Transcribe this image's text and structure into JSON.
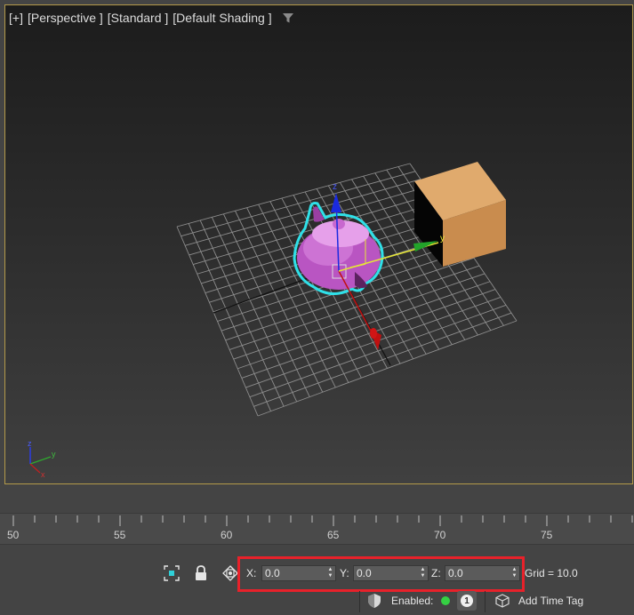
{
  "viewport": {
    "labels": [
      "[+]",
      "[Perspective ]",
      "[Standard ]",
      "[Default Shading ]"
    ],
    "axes": {
      "gizmo_x": "x",
      "gizmo_y": "y",
      "gizmo_z": "z"
    },
    "colors": {
      "border": "#b49a4a",
      "teapot": "#c060c8",
      "box": "#d39a5c",
      "selection": "#2fe0e8"
    }
  },
  "timeline": {
    "ticks": [
      "50",
      "55",
      "60",
      "65",
      "70",
      "75"
    ]
  },
  "statusbar": {
    "coords": {
      "x_label": "X:",
      "x_value": "0.0",
      "y_label": "Y:",
      "y_value": "0.0",
      "z_label": "Z:",
      "z_value": "0.0"
    },
    "grid": "Grid = 10.0",
    "enabled_label": "Enabled:",
    "badge_count": "1",
    "add_time_tag": "Add Time Tag",
    "highlight_color": "#e8212a"
  }
}
